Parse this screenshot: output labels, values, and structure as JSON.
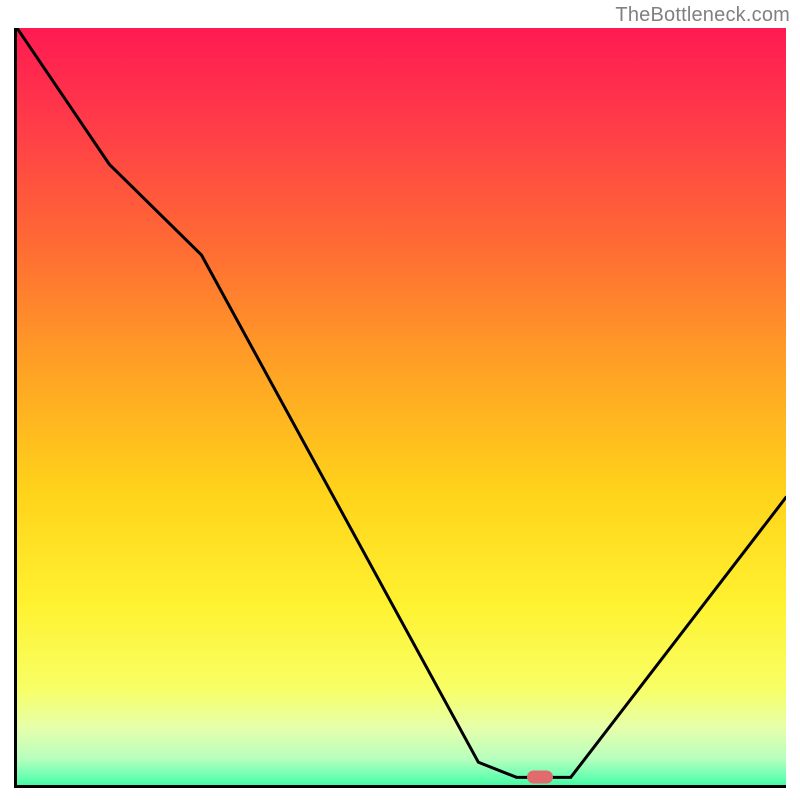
{
  "attribution": "TheBottleneck.com",
  "chart_data": {
    "type": "line",
    "title": "",
    "xlabel": "",
    "ylabel": "",
    "xlim": [
      0,
      100
    ],
    "ylim": [
      0,
      100
    ],
    "series": [
      {
        "name": "curve",
        "x": [
          0,
          12,
          24,
          60,
          65,
          72,
          100
        ],
        "values": [
          100,
          82,
          70,
          3,
          1,
          1,
          38
        ]
      }
    ],
    "marker": {
      "x": 68,
      "y": 1,
      "color": "#e26a6c"
    },
    "note": "x/y in percent of plot area; y=0 at bottom axis"
  },
  "gradient_stops": [
    {
      "offset": 0.0,
      "color": "#ff1a52"
    },
    {
      "offset": 0.12,
      "color": "#ff3a49"
    },
    {
      "offset": 0.28,
      "color": "#ff6a34"
    },
    {
      "offset": 0.45,
      "color": "#ffa424"
    },
    {
      "offset": 0.6,
      "color": "#ffd21a"
    },
    {
      "offset": 0.75,
      "color": "#fff230"
    },
    {
      "offset": 0.86,
      "color": "#f8ff66"
    },
    {
      "offset": 0.91,
      "color": "#e6ffab"
    },
    {
      "offset": 0.95,
      "color": "#b8ffbe"
    },
    {
      "offset": 0.975,
      "color": "#66ffb0"
    },
    {
      "offset": 1.0,
      "color": "#14f08e"
    }
  ],
  "curve_stroke": "#000000",
  "curve_width": 3
}
